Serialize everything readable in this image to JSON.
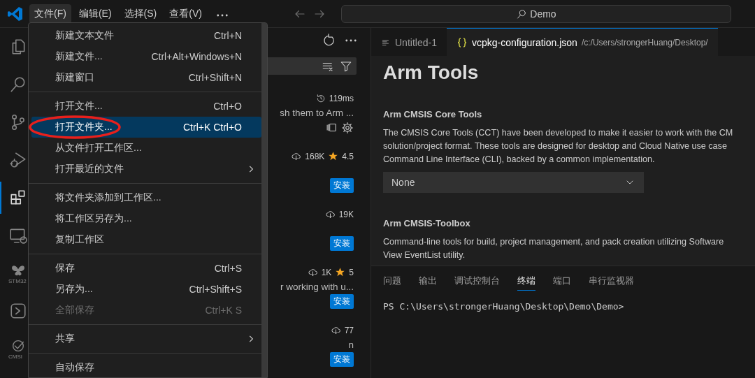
{
  "title_bar": {
    "menus": [
      {
        "label": "文件(F)",
        "selected": true
      },
      {
        "label": "编辑(E)",
        "selected": false
      },
      {
        "label": "选择(S)",
        "selected": false
      },
      {
        "label": "查看(V)",
        "selected": false
      }
    ],
    "search": {
      "label": "Demo"
    }
  },
  "activity_bar": {
    "items": [
      {
        "kind": "explorer",
        "selected": false
      },
      {
        "kind": "search",
        "selected": false
      },
      {
        "kind": "source_control",
        "selected": false
      },
      {
        "kind": "debug",
        "selected": false
      },
      {
        "kind": "extensions",
        "selected": true
      },
      {
        "kind": "remote",
        "selected": false
      },
      {
        "kind": "stm32",
        "label": "STM32",
        "selected": false
      },
      {
        "kind": "terminal",
        "selected": false
      },
      {
        "kind": "cmsis",
        "label": "CMSI",
        "selected": false
      }
    ]
  },
  "sidebar": {
    "extensions": [
      {
        "load_time": "119ms",
        "description": "sh them to Arm ...",
        "installed": true
      },
      {
        "downloads": "168K",
        "rating": "4.5",
        "installed": false,
        "install_label": "安装"
      },
      {
        "downloads": "19K",
        "installed": false,
        "install_label": "安装"
      },
      {
        "downloads": "1K",
        "rating": "5",
        "description": "r working with u...",
        "installed": false,
        "install_label": "安装"
      },
      {
        "downloads": "77",
        "description": "n",
        "installed": false,
        "install_label": "安装"
      }
    ]
  },
  "editor": {
    "tabs": [
      {
        "label": "Untitled-1",
        "kind": "text",
        "selected": false
      },
      {
        "label": "vcpkg-configuration.json",
        "kind": "json",
        "path": "/c:/Users/strongerHuang/Desktop/",
        "selected": true
      }
    ],
    "heading": "Arm Tools",
    "settings": [
      {
        "title": "Arm CMSIS Core Tools",
        "description": [
          "The CMSIS Core Tools (CCT) have been developed to make it easier to work with the CM",
          "solution/project format. These tools are designed for desktop and Cloud Native use case",
          "Command Line Interface (CLI), backed by a common implementation."
        ],
        "dropdown": "None"
      },
      {
        "title": "Arm CMSIS-Toolbox",
        "description": [
          "Command-line tools for build, project management, and pack creation utilizing Software",
          "View EventList utility."
        ]
      }
    ]
  },
  "panel": {
    "tabs": [
      {
        "label": "问题",
        "selected": false
      },
      {
        "label": "输出",
        "selected": false
      },
      {
        "label": "调试控制台",
        "selected": false
      },
      {
        "label": "终端",
        "selected": true
      },
      {
        "label": "端口",
        "selected": false
      },
      {
        "label": "串行监视器",
        "selected": false
      }
    ],
    "terminal": "PS C:\\Users\\strongerHuang\\Desktop\\Demo\\Demo>"
  },
  "menu": {
    "groups": [
      {
        "items": [
          {
            "label": "新建文本文件",
            "shortcut": "Ctrl+N",
            "selected": false,
            "disabled": false,
            "submenu": false,
            "circled": false
          },
          {
            "label": "新建文件...",
            "shortcut": "Ctrl+Alt+Windows+N",
            "selected": false,
            "disabled": false,
            "submenu": false,
            "circled": false
          },
          {
            "label": "新建窗口",
            "shortcut": "Ctrl+Shift+N",
            "selected": false,
            "disabled": false,
            "submenu": false,
            "circled": false
          }
        ]
      },
      {
        "items": [
          {
            "label": "打开文件...",
            "shortcut": "Ctrl+O",
            "selected": false,
            "disabled": false,
            "submenu": false,
            "circled": false
          },
          {
            "label": "打开文件夹...",
            "shortcut": "Ctrl+K Ctrl+O",
            "selected": true,
            "disabled": false,
            "submenu": false,
            "circled": true
          },
          {
            "label": "从文件打开工作区...",
            "selected": false,
            "disabled": false,
            "submenu": false,
            "circled": false
          },
          {
            "label": "打开最近的文件",
            "selected": false,
            "disabled": false,
            "submenu": true,
            "circled": false
          }
        ]
      },
      {
        "items": [
          {
            "label": "将文件夹添加到工作区...",
            "selected": false,
            "disabled": false,
            "submenu": false,
            "circled": false
          },
          {
            "label": "将工作区另存为...",
            "selected": false,
            "disabled": false,
            "submenu": false,
            "circled": false
          },
          {
            "label": "复制工作区",
            "selected": false,
            "disabled": false,
            "submenu": false,
            "circled": false
          }
        ]
      },
      {
        "items": [
          {
            "label": "保存",
            "shortcut": "Ctrl+S",
            "selected": false,
            "disabled": false,
            "submenu": false,
            "circled": false
          },
          {
            "label": "另存为...",
            "shortcut": "Ctrl+Shift+S",
            "selected": false,
            "disabled": false,
            "submenu": false,
            "circled": false
          },
          {
            "label": "全部保存",
            "shortcut": "Ctrl+K S",
            "selected": false,
            "disabled": true,
            "submenu": false,
            "circled": false
          }
        ]
      },
      {
        "items": [
          {
            "label": "共享",
            "selected": false,
            "disabled": false,
            "submenu": true,
            "circled": false
          }
        ]
      },
      {
        "items": [
          {
            "label": "自动保存",
            "selected": false,
            "disabled": false,
            "submenu": false,
            "circled": false
          }
        ]
      }
    ]
  }
}
